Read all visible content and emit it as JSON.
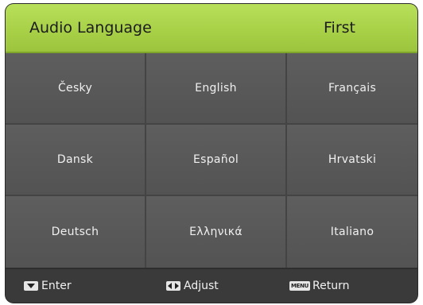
{
  "header": {
    "title": "Audio Language",
    "value": "First"
  },
  "languages": [
    {
      "label": "Česky"
    },
    {
      "label": "English"
    },
    {
      "label": "Français"
    },
    {
      "label": "Dansk"
    },
    {
      "label": "Español"
    },
    {
      "label": "Hrvatski"
    },
    {
      "label": "Deutsch"
    },
    {
      "label": "Ελληνικά"
    },
    {
      "label": "Italiano"
    }
  ],
  "footer": {
    "enter_label": "Enter",
    "adjust_label": "Adjust",
    "return_label": "Return",
    "menu_key_text": "MENU"
  },
  "colors": {
    "header_green": "#a8d148",
    "panel_gray": "#3a3a3a",
    "cell_gray": "#5a5a5a"
  },
  "icons": {
    "enter": "down-arrow-key-icon",
    "adjust": "left-right-arrows-key-icon",
    "return": "menu-key-icon"
  }
}
